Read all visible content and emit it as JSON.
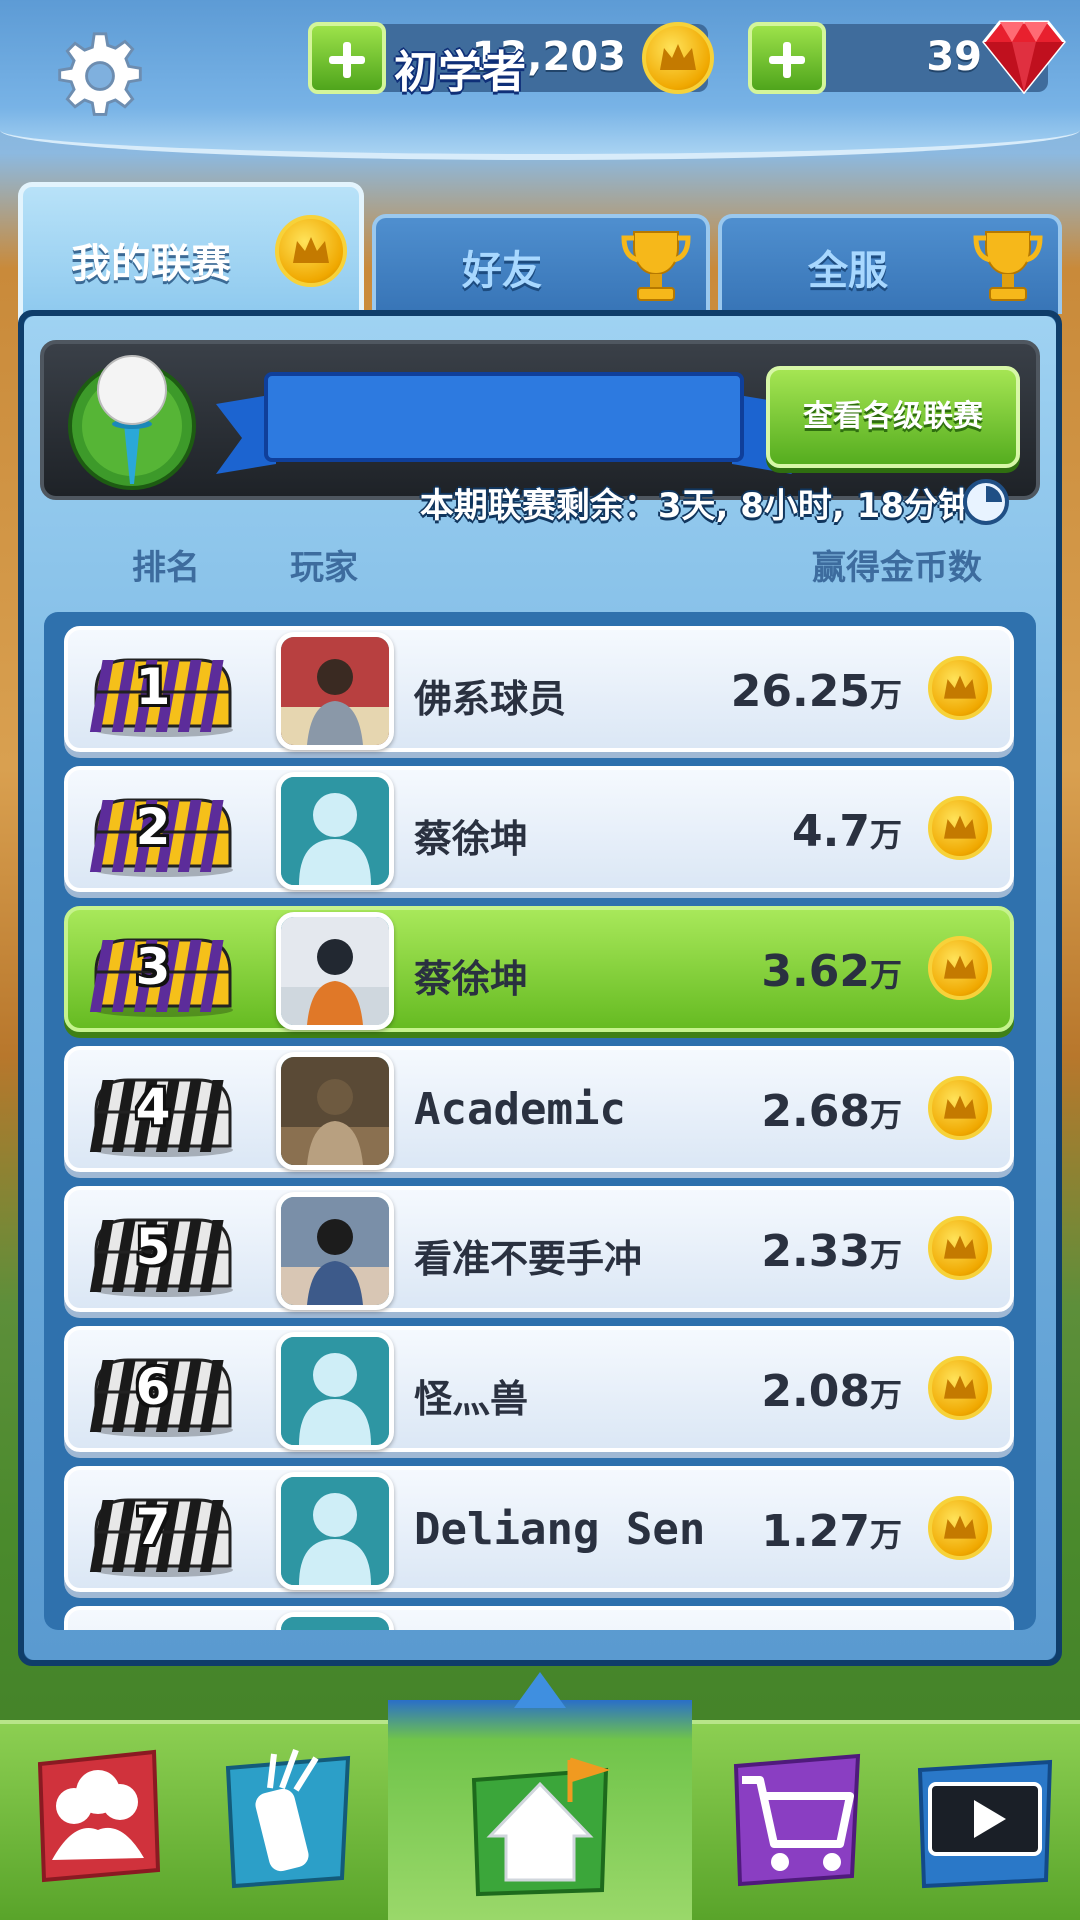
{
  "header": {
    "coins": "13,203",
    "gems": "39",
    "colors": {
      "coin_gold": "#f0a800",
      "gem_red": "#e8202e",
      "plus_green": "#6cc42a"
    }
  },
  "tabs": [
    {
      "label": "我的联赛",
      "icon": "coin-crown-icon",
      "active": true
    },
    {
      "label": "好友",
      "icon": "trophy-icon",
      "active": false
    },
    {
      "label": "全服",
      "icon": "trophy-icon",
      "active": false
    }
  ],
  "league": {
    "tier": "初学者",
    "view_button": "查看各级联赛",
    "countdown": "本期联赛剩余：3天, 8小时, 18分钟"
  },
  "columns": {
    "rank": "排名",
    "player": "玩家",
    "coins": "赢得金币数"
  },
  "leaderboard": [
    {
      "rank": "1",
      "name": "佛系球员",
      "score": "26.25",
      "unit": "万",
      "chest": "purple-gold",
      "avatar": "photo-man-poster",
      "highlight": false
    },
    {
      "rank": "2",
      "name": "蔡徐坤",
      "score": "4.7",
      "unit": "万",
      "chest": "purple-gold",
      "avatar": "default-silhouette",
      "highlight": false
    },
    {
      "rank": "3",
      "name": "蔡徐坤",
      "score": "3.62",
      "unit": "万",
      "chest": "purple-gold",
      "avatar": "photo-basketball",
      "highlight": true
    },
    {
      "rank": "4",
      "name": "Academic",
      "score": "2.68",
      "unit": "万",
      "chest": "silver-black",
      "avatar": "photo-monkey",
      "highlight": false
    },
    {
      "rank": "5",
      "name": "看准不要手冲",
      "score": "2.33",
      "unit": "万",
      "chest": "silver-black",
      "avatar": "photo-man-drinking",
      "highlight": false
    },
    {
      "rank": "6",
      "name": "怪灬兽",
      "score": "2.08",
      "unit": "万",
      "chest": "silver-black",
      "avatar": "default-silhouette",
      "highlight": false
    },
    {
      "rank": "7",
      "name": "Deliang Sen",
      "score": "1.27",
      "unit": "万",
      "chest": "silver-black",
      "avatar": "default-silhouette",
      "highlight": false
    }
  ],
  "bottom_nav": [
    {
      "name": "clubs-icon",
      "color": "#d0323c"
    },
    {
      "name": "golf-bag-icon",
      "color": "#2c9fc8"
    },
    {
      "name": "home-icon",
      "color": "#3ba63a"
    },
    {
      "name": "shop-cart-icon",
      "color": "#8a3ec2"
    },
    {
      "name": "replay-tv-icon",
      "color": "#2a78c8"
    }
  ]
}
